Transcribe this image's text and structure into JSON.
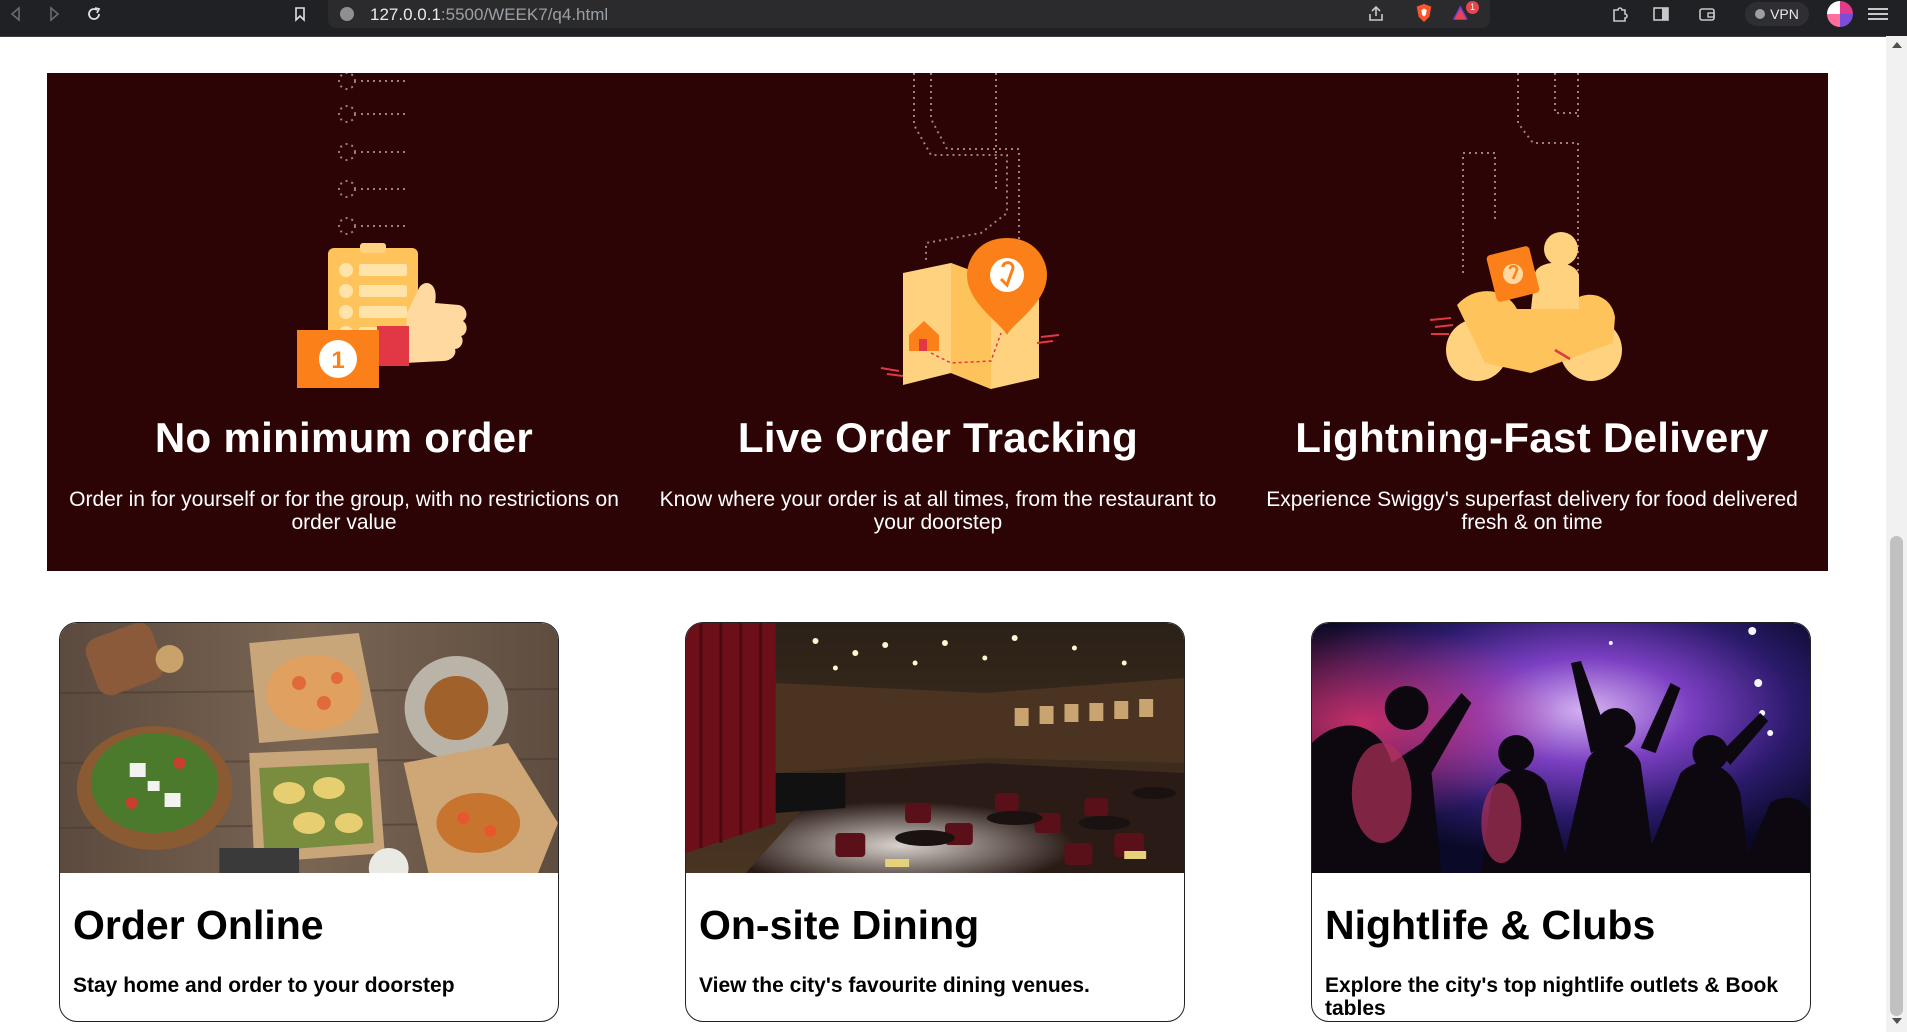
{
  "browser": {
    "url_host": "127.0.0.1",
    "url_rest": ":5500/WEEK7/q4.html",
    "vpn_label": "VPN",
    "notification_count": "1"
  },
  "features": [
    {
      "title": "No minimum order",
      "description": "Order in for yourself or for the group, with no restrictions on order value",
      "icon": "thumbs-up-order-icon"
    },
    {
      "title": "Live Order Tracking",
      "description": "Know where your order is at all times, from the restaurant to your doorstep",
      "icon": "map-pin-icon"
    },
    {
      "title": "Lightning-Fast Delivery",
      "description": "Experience Swiggy's superfast delivery for food delivered fresh & on time",
      "icon": "delivery-scooter-icon"
    }
  ],
  "cards": [
    {
      "title": "Order Online",
      "description": "Stay home and order to your doorstep"
    },
    {
      "title": "On-site Dining",
      "description": "View the city's favourite dining venues."
    },
    {
      "title": "Nightlife & Clubs",
      "description": "Explore the city's top nightlife outlets & Book tables"
    }
  ],
  "colors": {
    "band_background": "#2d0406",
    "accent_orange": "#fc8019",
    "icon_cream": "#ffd27f"
  }
}
